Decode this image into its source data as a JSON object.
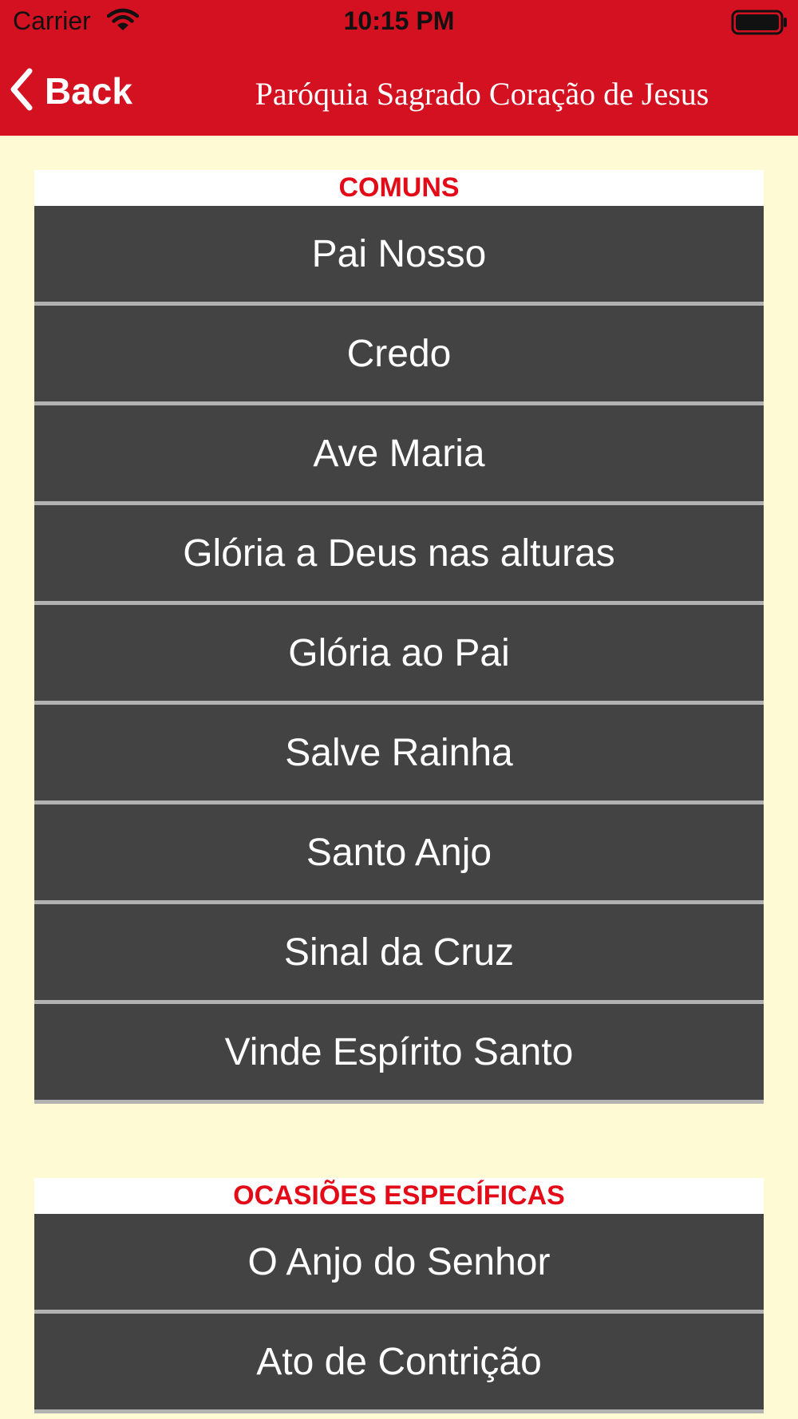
{
  "status_bar": {
    "carrier": "Carrier",
    "time": "10:15 PM",
    "icons": [
      "wifi-icon",
      "battery-icon"
    ]
  },
  "nav": {
    "back_label": "Back",
    "title": "Paróquia Sagrado Coração de Jesus"
  },
  "colors": {
    "nav_background": "#D31120",
    "page_background": "#FEFAD3",
    "row_background": "#434343",
    "section_title": "#E30B17"
  },
  "sections": [
    {
      "title": "COMUNS",
      "items": [
        "Pai Nosso",
        "Credo",
        "Ave Maria",
        "Glória a Deus nas alturas",
        "Glória ao Pai",
        "Salve Rainha",
        "Santo Anjo",
        "Sinal da Cruz",
        "Vinde Espírito Santo"
      ]
    },
    {
      "title": "OCASIÕES ESPECÍFICAS",
      "items": [
        "O Anjo do Senhor",
        "Ato de Contrição"
      ]
    }
  ]
}
